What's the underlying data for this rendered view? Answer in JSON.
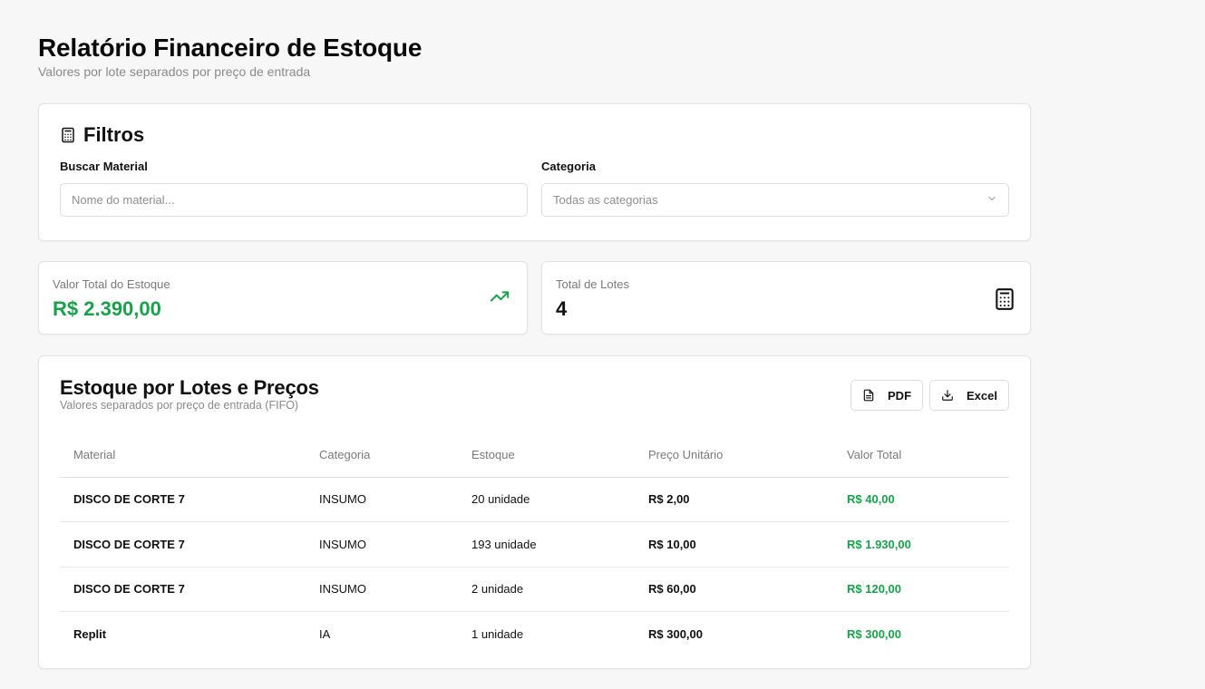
{
  "header": {
    "title": "Relatório Financeiro de Estoque",
    "subtitle": "Valores por lote separados por preço de entrada"
  },
  "filters": {
    "title": "Filtros",
    "icon": "calculator-icon",
    "search": {
      "label": "Buscar Material",
      "placeholder": "Nome do material..."
    },
    "category": {
      "label": "Categoria",
      "selected": "Todas as categorias"
    }
  },
  "stats": {
    "total_value": {
      "label": "Valor Total do Estoque",
      "value": "R$ 2.390,00",
      "icon": "trending-up-icon",
      "color": "#16a34a"
    },
    "total_lots": {
      "label": "Total de Lotes",
      "value": "4",
      "icon": "calculator-icon"
    }
  },
  "table": {
    "title": "Estoque por Lotes e Preços",
    "subtitle": "Valores separados por preço de entrada (FIFO)",
    "actions": {
      "pdf": "PDF",
      "excel": "Excel"
    },
    "columns": [
      "Material",
      "Categoria",
      "Estoque",
      "Preço Unitário",
      "Valor Total"
    ],
    "rows": [
      {
        "material": "DISCO DE CORTE 7",
        "category": "INSUMO",
        "stock": "20 unidade",
        "unit_price": "R$ 2,00",
        "total": "R$ 40,00"
      },
      {
        "material": "DISCO DE CORTE 7",
        "category": "INSUMO",
        "stock": "193 unidade",
        "unit_price": "R$ 10,00",
        "total": "R$ 1.930,00"
      },
      {
        "material": "DISCO DE CORTE 7",
        "category": "INSUMO",
        "stock": "2 unidade",
        "unit_price": "R$ 60,00",
        "total": "R$ 120,00"
      },
      {
        "material": "Replit",
        "category": "IA",
        "stock": "1 unidade",
        "unit_price": "R$ 300,00",
        "total": "R$ 300,00"
      }
    ]
  }
}
